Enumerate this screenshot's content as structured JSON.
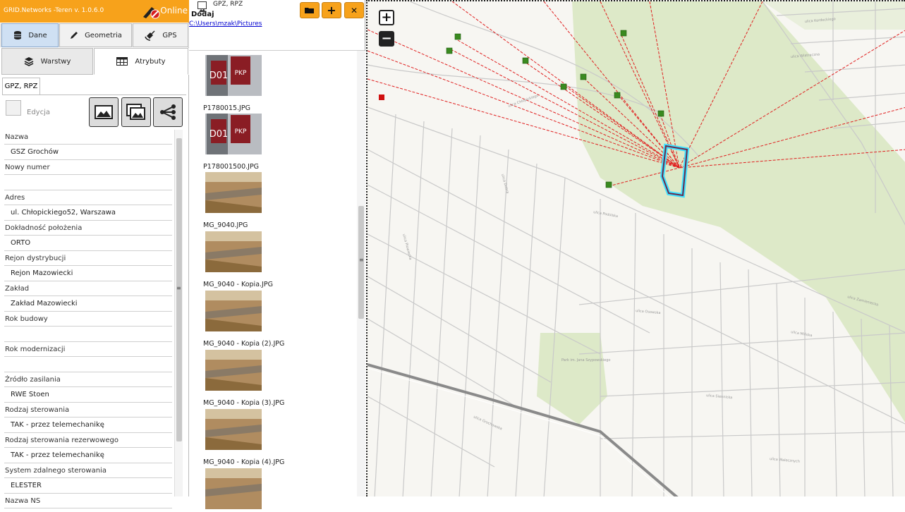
{
  "app": {
    "title": "GRID.Networks -Teren v. 1.0.6.0",
    "status": "Online"
  },
  "tabs_main": [
    {
      "label": "Dane",
      "icon": "database-icon"
    },
    {
      "label": "Geometria",
      "icon": "pencil-icon"
    },
    {
      "label": "GPS",
      "icon": "satellite-icon"
    }
  ],
  "tabs_sub": [
    {
      "label": "Warstwy",
      "icon": "layers-icon"
    },
    {
      "label": "Atrybuty",
      "icon": "table-icon"
    }
  ],
  "section_tab": "GPZ, RPZ",
  "edit_label": "Edycja",
  "attributes": [
    {
      "label": "Nazwa",
      "value": "GSZ Grochów"
    },
    {
      "label": "Nowy numer",
      "value": ""
    },
    {
      "label": "Adres",
      "value": "ul. Chłopickiego52, Warszawa"
    },
    {
      "label": "Dokładność położenia",
      "value": "ORTO"
    },
    {
      "label": "Rejon dystrybucji",
      "value": "Rejon Mazowiecki"
    },
    {
      "label": "Zakład",
      "value": "Zakład Mazowiecki"
    },
    {
      "label": "Rok budowy",
      "value": ""
    },
    {
      "label": "Rok modernizacji",
      "value": ""
    },
    {
      "label": "Źródło zasilania",
      "value": "RWE Stoen"
    },
    {
      "label": "Rodzaj sterowania",
      "value": "TAK - przez telemechanikę"
    },
    {
      "label": "Rodzaj sterowania rezerwowego",
      "value": "TAK - przez telemechanikę"
    },
    {
      "label": "System zdalnego sterowania",
      "value": "ELESTER"
    },
    {
      "label": "Nazwa NS",
      "value": ""
    }
  ],
  "photos": {
    "title": "GPZ, RPZ",
    "add_label": "Dodaj",
    "path": "C:\\Users\\mzak\\Pictures",
    "items": [
      {
        "name": "P1780015.JPG",
        "kind": "sign"
      },
      {
        "name": "P178001500.JPG",
        "kind": "sign"
      },
      {
        "name": "MG_9040.JPG",
        "kind": "brush"
      },
      {
        "name": "MG_9040 - Kopia.JPG",
        "kind": "brush"
      },
      {
        "name": "MG_9040 - Kopia (2).JPG",
        "kind": "brush"
      },
      {
        "name": "MG_9040 - Kopia (3).JPG",
        "kind": "brush"
      },
      {
        "name": "MG_9040 - Kopia (4).JPG",
        "kind": "brush"
      }
    ]
  },
  "map": {
    "zoom_in": "+",
    "zoom_out": "−",
    "labels": [
      "ulica Chłopickiego",
      "ulica Grochowska",
      "ulica Podolska",
      "ulica Wiatraczna",
      "ulica Kordeckiego",
      "ulica Osowska",
      "ulica Siennicka",
      "Park im. Jana Szypowskiego",
      "ulica Dobra",
      "ulica Zamieniecka",
      "ulica Mińska",
      "ulica Płowiecka",
      "ulica Walecznych"
    ],
    "colors": {
      "lines": "#e02020",
      "nodes": "#3a8a20",
      "station": "#6a2a4a",
      "highlight": "#40e0ff",
      "green": "#dde9c8"
    }
  }
}
